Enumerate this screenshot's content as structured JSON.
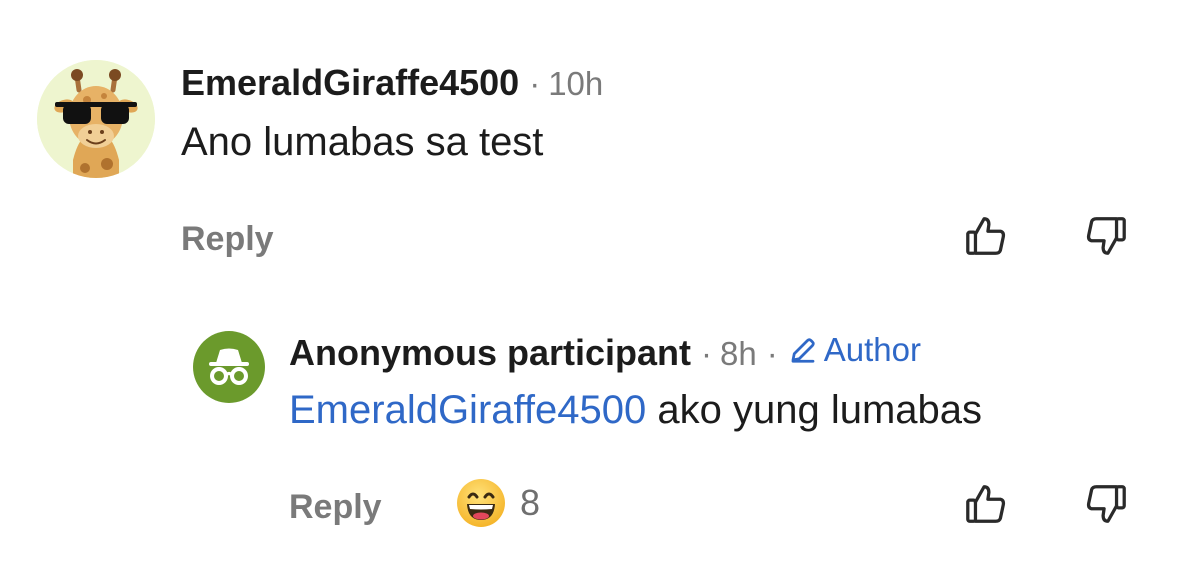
{
  "comments": [
    {
      "username": "EmeraldGiraffe4500",
      "separator": "·",
      "time": "10h",
      "text": "Ano lumabas sa test",
      "reply_label": "Reply",
      "avatar_icon": "giraffe-sunglasses-avatar"
    },
    {
      "username": "Anonymous participant",
      "separator": "·",
      "time": "8h",
      "separator2": "·",
      "badge": "Author",
      "mention": "EmeraldGiraffe4500",
      "text": " ako yung lumabas",
      "reply_label": "Reply",
      "reaction_icon": "grinning-face-emoji",
      "reaction_count": "8",
      "avatar_icon": "incognito-icon"
    }
  ],
  "colors": {
    "accent_blue": "#2f68c7",
    "muted_gray": "#7a7a7a",
    "text_dark": "#1c1c1c",
    "anon_avatar_green": "#6b9a2c"
  }
}
